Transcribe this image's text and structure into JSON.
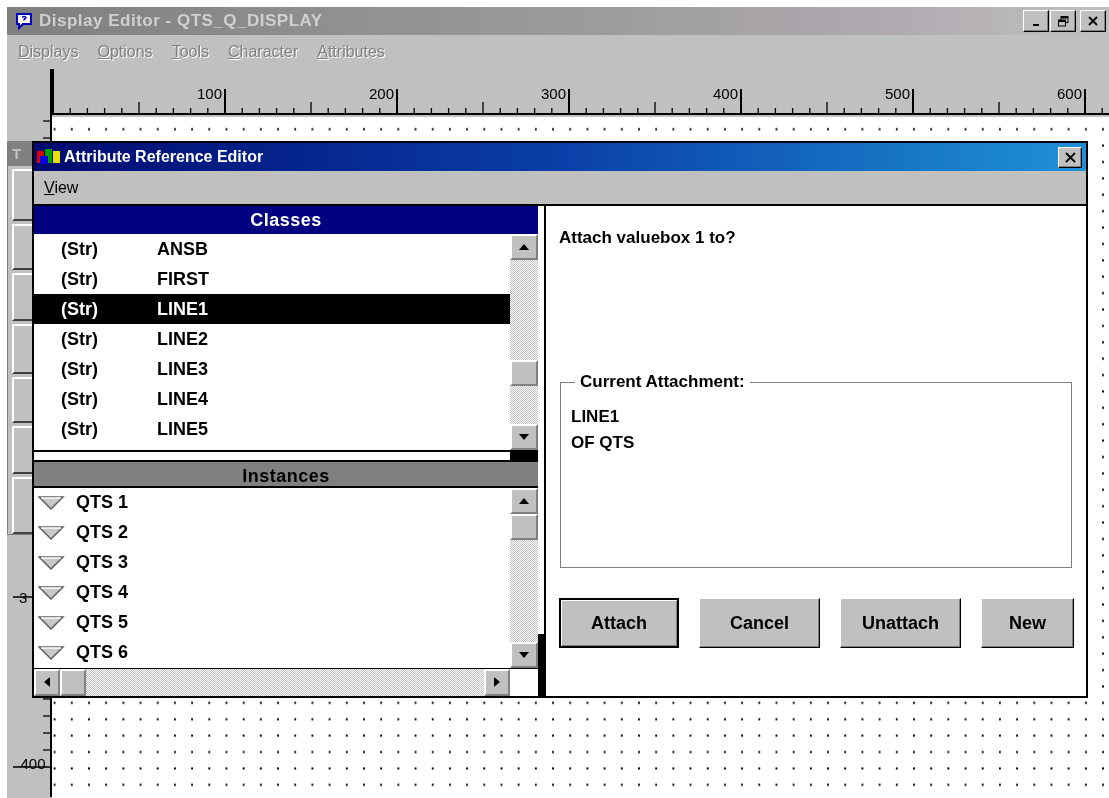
{
  "window": {
    "title": "Display Editor - QTS_Q_DISPLAY",
    "active": false
  },
  "menu": [
    {
      "label": "Displays",
      "disabled": true
    },
    {
      "label": "Options",
      "disabled": true
    },
    {
      "label": "Tools",
      "disabled": true
    },
    {
      "label": "Character",
      "disabled": true
    },
    {
      "label": "Attributes",
      "disabled": true
    }
  ],
  "ruler": {
    "labels": [
      "100",
      "200",
      "300",
      "400",
      "500",
      "600"
    ]
  },
  "vertical_ruler": {
    "labels": [
      "3",
      "400"
    ]
  },
  "toolbox": {
    "title": "T"
  },
  "dialog": {
    "title": "Attribute Reference Editor",
    "active": true,
    "menu": [
      {
        "label": "View"
      }
    ],
    "classes": {
      "header": "Classes",
      "items": [
        {
          "type": "(Str)",
          "name": "ANSB",
          "selected": false
        },
        {
          "type": "(Str)",
          "name": "FIRST",
          "selected": false
        },
        {
          "type": "(Str)",
          "name": "LINE1",
          "selected": true
        },
        {
          "type": "(Str)",
          "name": "LINE2",
          "selected": false
        },
        {
          "type": "(Str)",
          "name": "LINE3",
          "selected": false
        },
        {
          "type": "(Str)",
          "name": "LINE4",
          "selected": false
        },
        {
          "type": "(Str)",
          "name": "LINE5",
          "selected": false
        }
      ]
    },
    "instances": {
      "header": "Instances",
      "items": [
        {
          "label": "QTS 1",
          "selected": false
        },
        {
          "label": "QTS 2",
          "selected": false
        },
        {
          "label": "QTS 3",
          "selected": false
        },
        {
          "label": "QTS 4",
          "selected": false
        },
        {
          "label": "QTS 5",
          "selected": false
        },
        {
          "label": "QTS 6",
          "selected": false
        }
      ]
    },
    "prompt": "Attach valuebox 1 to?",
    "current_attachment": {
      "legend": "Current Attachment:",
      "lines": [
        "LINE1",
        "OF QTS"
      ]
    },
    "buttons": [
      {
        "label": "Attach",
        "default": true
      },
      {
        "label": "Cancel",
        "default": false
      },
      {
        "label": "Unattach",
        "default": false
      },
      {
        "label": "New",
        "default": false
      }
    ]
  }
}
